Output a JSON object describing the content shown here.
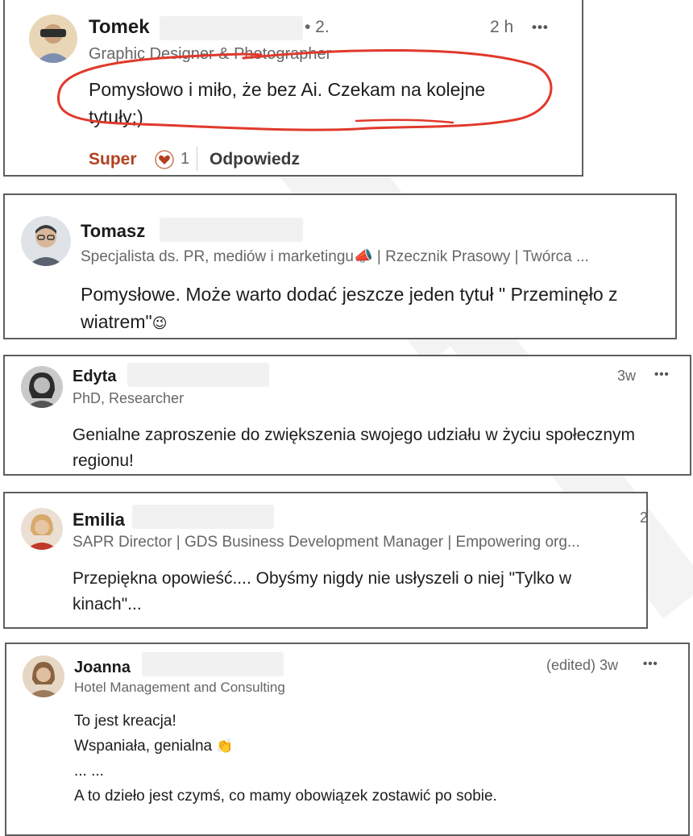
{
  "comments": [
    {
      "author": "Tomek",
      "degree": "• 2.",
      "time": "2 h",
      "more": "•••",
      "headline": "Graphic Designer & Photographer",
      "text_lines": [
        "Pomysłowo i miło, że bez Ai. Czekam na kolejne",
        "tytuły;)"
      ],
      "reaction_label": "Super",
      "reaction_count": "1",
      "reply_label": "Odpowiedz",
      "annotation_color": "#e0392b"
    },
    {
      "author": "Tomasz",
      "headline": "Specjalista ds. PR, mediów i marketingu📣 | Rzecznik Prasowy | Twórca ...",
      "text_lines": [
        "Pomysłowe. Może warto dodać jeszcze jeden tytuł \" Przeminęło z",
        "wiatrem\""
      ],
      "emoji": "😉"
    },
    {
      "author": "Edyta",
      "time": "3w",
      "more": "•••",
      "headline": "PhD, Researcher",
      "text_lines": [
        "Genialne zaproszenie do zwiększenia swojego udziału w życiu społecznym",
        "regionu!"
      ]
    },
    {
      "author": "Emilia",
      "time_fragment": "2",
      "headline": "SAPR Director | GDS Business Development Manager | Empowering org...",
      "text_lines": [
        "Przepiękna opowieść.... Obyśmy nigdy nie usłyszeli o niej \"Tylko w",
        "kinach\"..."
      ]
    },
    {
      "author": "Joanna",
      "time": "(edited) 3w",
      "more": "•••",
      "headline": "Hotel Management and Consulting",
      "text_lines": [
        "To jest kreacja!",
        "Wspaniała, genialna",
        "... ...",
        "A to dzieło jest czymś, co mamy obowiązek zostawić po sobie."
      ],
      "emoji": "👏"
    }
  ],
  "colors": {
    "reaction_accent": "#b24020",
    "border": "#5e5e5e",
    "secondary_text": "#666666",
    "annotation": "#e0392b"
  }
}
